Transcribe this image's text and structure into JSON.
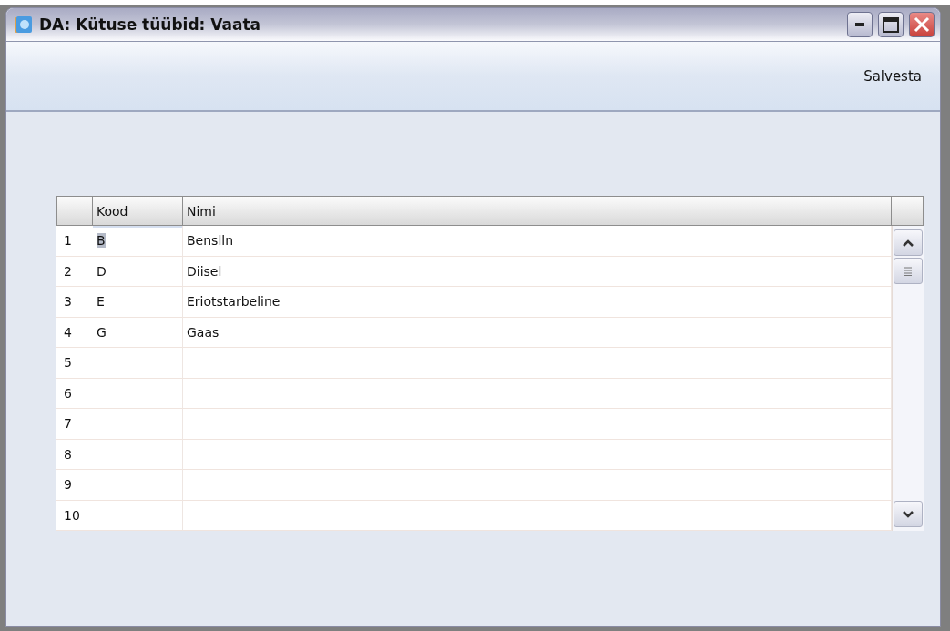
{
  "window": {
    "title": "DA: Kütuse tüübid: Vaata"
  },
  "toolbar": {
    "buttons": [
      "Salvesta"
    ]
  },
  "table": {
    "columns": [
      "Kood",
      "Nimi"
    ],
    "rows": [
      {
        "number": "1",
        "kood": "B",
        "nimi": "Benslln",
        "selected": true
      },
      {
        "number": "2",
        "kood": "D",
        "nimi": "Diisel",
        "selected": false
      },
      {
        "number": "3",
        "kood": "E",
        "nimi": "Eriotstarbeline",
        "selected": false
      },
      {
        "number": "4",
        "kood": "G",
        "nimi": "Gaas",
        "selected": false
      },
      {
        "number": "5",
        "selected": false
      },
      {
        "number": "6",
        "selected": false
      },
      {
        "number": "7",
        "selected": false
      },
      {
        "number": "8",
        "selected": false
      },
      {
        "number": "9",
        "selected": false
      },
      {
        "number": "10",
        "selected": false
      }
    ]
  }
}
